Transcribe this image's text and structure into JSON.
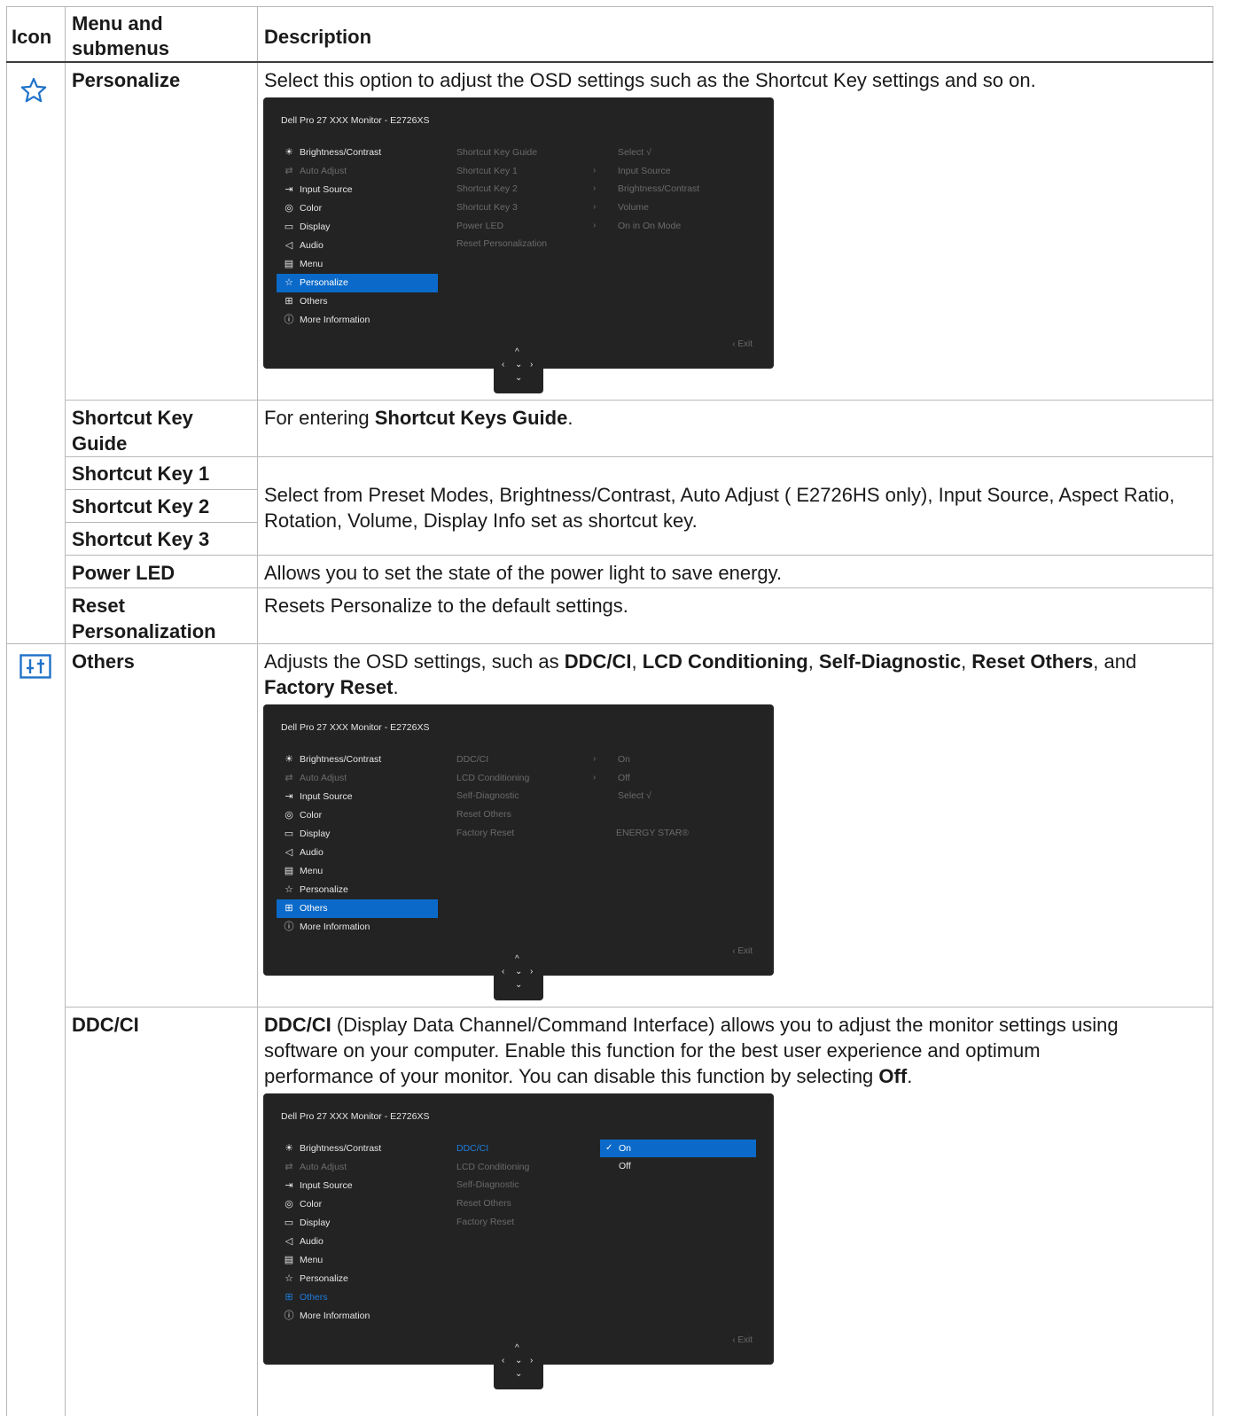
{
  "header": {
    "icon": "Icon",
    "menu": "Menu and submenus",
    "description": "Description"
  },
  "rows": {
    "personalize": {
      "icon": "star-icon",
      "menu": "Personalize",
      "desc": "Select this option to adjust the OSD settings such as the Shortcut Key settings and so on."
    },
    "shortcut_key_guide": {
      "menu": "Shortcut Key Guide",
      "desc_prefix": "For entering ",
      "desc_bold": "Shortcut Keys Guide",
      "desc_suffix": "."
    },
    "shortcut_key_1": {
      "menu": "Shortcut Key 1"
    },
    "shortcut_key_2": {
      "menu": "Shortcut Key 2"
    },
    "shortcut_key_3": {
      "menu": "Shortcut Key 3"
    },
    "shortcut_keys_desc": "Select from Preset Modes, Brightness/Contrast, Auto Adjust ( E2726HS only), Input Source, Aspect Ratio, Rotation, Volume, Display Info set as shortcut key.",
    "power_led": {
      "menu": "Power LED",
      "desc": "Allows you to set the state of the power light to save energy."
    },
    "reset_personalization": {
      "menu": "Reset Personalization",
      "desc": "Resets Personalize to the default settings."
    },
    "others": {
      "icon": "others-icon",
      "menu": "Others",
      "desc_1": "Adjusts the OSD settings, such as ",
      "b1": "DDC/CI",
      "s1": ", ",
      "b2": "LCD Conditioning",
      "s2": ", ",
      "b3": "Self-Diagnostic",
      "s3": ", ",
      "b4": "Reset Others",
      "s4": ", and",
      "b5": "Factory Reset",
      "s5": "."
    },
    "ddc_ci": {
      "menu": "DDC/CI",
      "b1": "DDC/CI",
      "desc_1": " (Display Data Channel/Command Interface) allows you to adjust the monitor settings using software on your computer. Enable this function for the best user experience and optimum performance of your monitor. You can disable this function by selecting ",
      "b2": "Off",
      "desc_2": "."
    }
  },
  "osd": {
    "title": "Dell Pro 27 XXX Monitor - E2726XS",
    "nav": [
      {
        "icon": "sun-icon",
        "glyph": "☀",
        "label": "Brightness/Contrast"
      },
      {
        "icon": "auto-adjust-icon",
        "glyph": "⇄",
        "label": "Auto Adjust"
      },
      {
        "icon": "input-source-icon",
        "glyph": "⇥",
        "label": "Input Source"
      },
      {
        "icon": "palette-icon",
        "glyph": "◎",
        "label": "Color"
      },
      {
        "icon": "monitor-icon",
        "glyph": "▭",
        "label": "Display"
      },
      {
        "icon": "speaker-icon",
        "glyph": "◁",
        "label": "Audio"
      },
      {
        "icon": "menu-icon",
        "glyph": "▤",
        "label": "Menu"
      },
      {
        "icon": "star-icon",
        "glyph": "☆",
        "label": "Personalize"
      },
      {
        "icon": "others-icon",
        "glyph": "⊞",
        "label": "Others"
      },
      {
        "icon": "info-icon",
        "glyph": "ⓘ",
        "label": "More Information"
      }
    ],
    "personalize_sub": [
      "Shortcut Key Guide",
      "Shortcut Key 1",
      "Shortcut Key 2",
      "Shortcut Key 3",
      "Power LED",
      "Reset Personalization"
    ],
    "personalize_vals": [
      "Select √",
      "Input Source",
      "Brightness/Contrast",
      "Volume",
      "On in On Mode"
    ],
    "others_sub": [
      "DDC/CI",
      "LCD Conditioning",
      "Self-Diagnostic",
      "Reset Others",
      "Factory Reset"
    ],
    "others_vals": [
      "On",
      "Off",
      "Select √",
      "",
      "ENERGY STAR®"
    ],
    "ddc_options": [
      "On",
      "Off"
    ],
    "arrow": "›",
    "exit": "‹  Exit",
    "joystick": {
      "up": "^",
      "left": "‹",
      "center": "⌄",
      "right": "›",
      "down": "⌄"
    }
  },
  "colors": {
    "accent": "#0b6ac9",
    "icon_blue": "#1f72c9",
    "osd_bg": "#232323"
  }
}
